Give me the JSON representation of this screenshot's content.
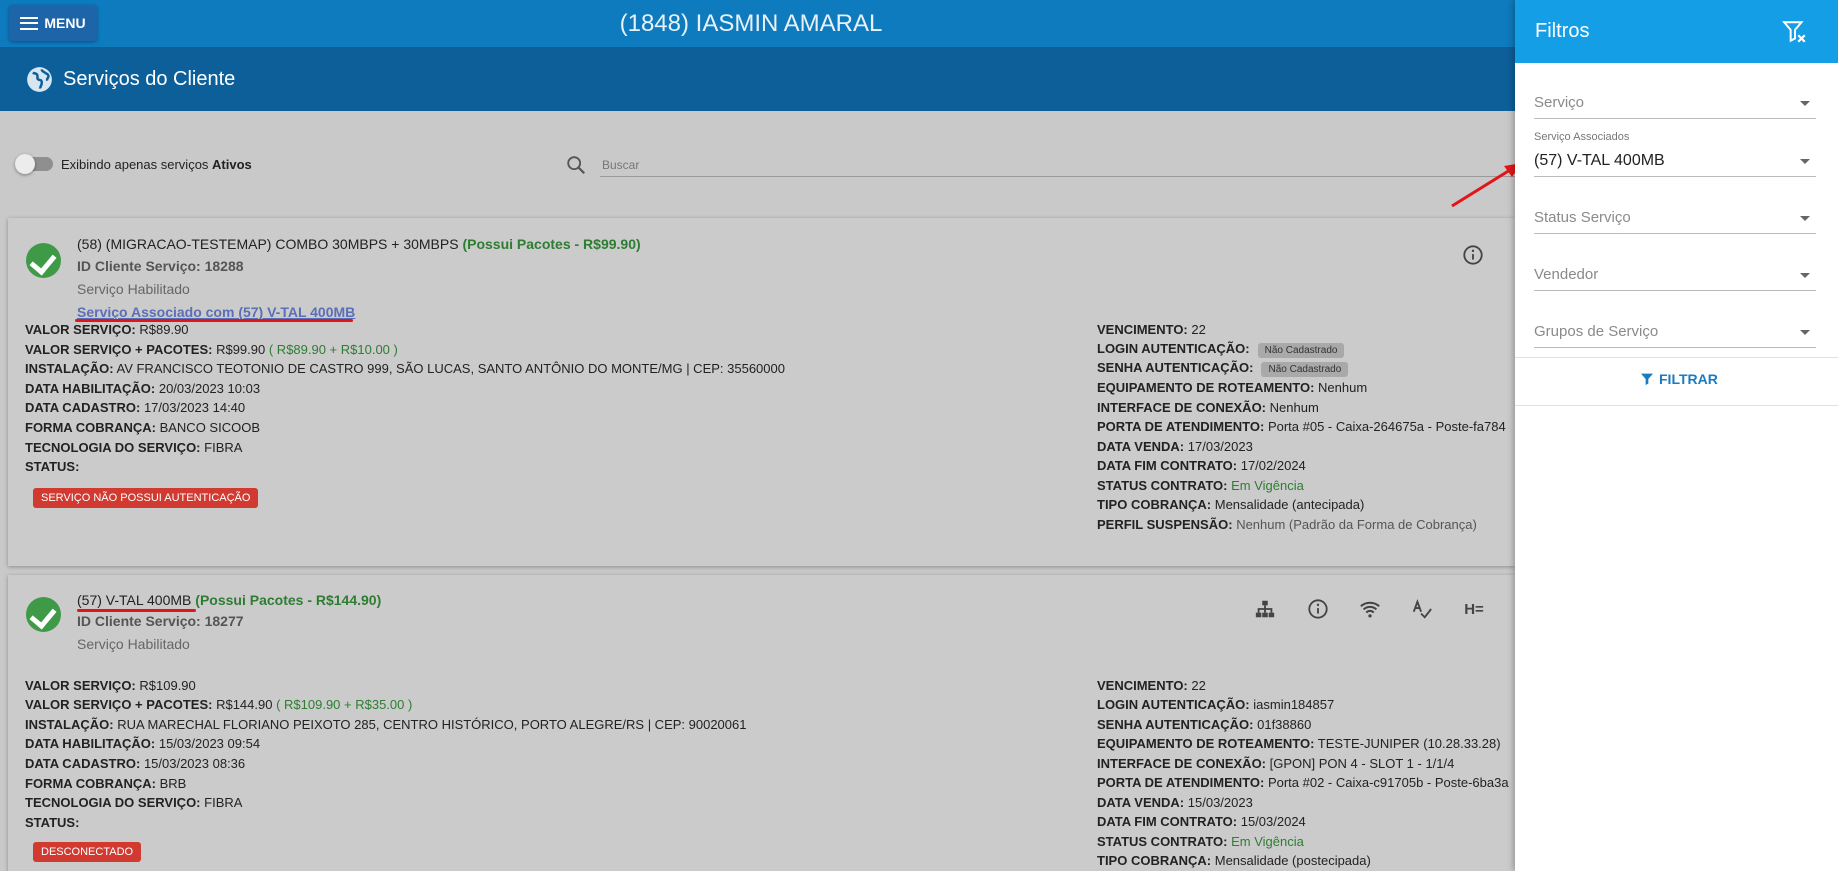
{
  "topbar": {
    "menu_label": "MENU",
    "client_title": "(1848) IASMIN AMARAL"
  },
  "subheader": {
    "title": "Serviços do Cliente",
    "icon": "globe-icon"
  },
  "toolbar": {
    "toggle_prefix": "Exibindo apenas serviços",
    "toggle_bold": "Ativos",
    "search_placeholder": "Buscar"
  },
  "services": [
    {
      "name": "(58) (MIGRACAO-TESTEMAP) COMBO 30MBPS + 30MBPS",
      "packages": "(Possui Pacotes - R$99.90)",
      "id_line": "ID Cliente Serviço: 18288",
      "status_text": "Serviço Habilitado",
      "associated_link": "Serviço Associado com (57) V-TAL 400MB",
      "left": {
        "valor_servico_lbl": "VALOR SERVIÇO:",
        "valor_servico": "R$89.90",
        "valor_pacotes_lbl": "VALOR SERVIÇO + PACOTES:",
        "valor_pacotes": "R$99.90",
        "valor_pacotes_detail": "( R$89.90 + R$10.00 )",
        "instalacao_lbl": "INSTALAÇÃO:",
        "instalacao": "AV FRANCISCO TEOTONIO DE CASTRO 999, SÃO LUCAS, SANTO ANTÔNIO DO MONTE/MG | CEP: 35560000",
        "data_hab_lbl": "DATA HABILITAÇÃO:",
        "data_hab": "20/03/2023 10:03",
        "data_cad_lbl": "DATA CADASTRO:",
        "data_cad": "17/03/2023 14:40",
        "forma_lbl": "FORMA COBRANÇA:",
        "forma": "BANCO SICOOB",
        "tec_lbl": "TECNOLOGIA DO SERVIÇO:",
        "tec": "FIBRA",
        "status_lbl": "STATUS:",
        "status_badge": "SERVIÇO NÃO POSSUI AUTENTICAÇÃO"
      },
      "right": {
        "venc_lbl": "VENCIMENTO:",
        "venc": "22",
        "login_lbl": "LOGIN AUTENTICAÇÃO:",
        "login_badge": "Não Cadastrado",
        "senha_lbl": "SENHA AUTENTICAÇÃO:",
        "senha_badge": "Não Cadastrado",
        "equip_lbl": "EQUIPAMENTO DE ROTEAMENTO:",
        "equip": "Nenhum",
        "interface_lbl": "INTERFACE DE CONEXÃO:",
        "interface": "Nenhum",
        "porta_lbl": "PORTA DE ATENDIMENTO:",
        "porta": "Porta #05 - Caixa-264675a - Poste-fa784",
        "data_venda_lbl": "DATA VENDA:",
        "data_venda": "17/03/2023",
        "data_fim_lbl": "DATA FIM CONTRATO:",
        "data_fim": "17/02/2024",
        "status_contrato_lbl": "STATUS CONTRATO:",
        "status_contrato": "Em Vigência",
        "tipo_cob_lbl": "TIPO COBRANÇA:",
        "tipo_cob": "Mensalidade (antecipada)",
        "perfil_lbl": "PERFIL SUSPENSÃO:",
        "perfil": "Nenhum (Padrão da Forma de Cobrança)"
      }
    },
    {
      "name": "(57) V-TAL 400MB",
      "packages": "(Possui Pacotes - R$144.90)",
      "id_line": "ID Cliente Serviço: 18277",
      "status_text": "Serviço Habilitado",
      "left": {
        "valor_servico_lbl": "VALOR SERVIÇO:",
        "valor_servico": "R$109.90",
        "valor_pacotes_lbl": "VALOR SERVIÇO + PACOTES:",
        "valor_pacotes": "R$144.90",
        "valor_pacotes_detail": "( R$109.90 + R$35.00 )",
        "instalacao_lbl": "INSTALAÇÃO:",
        "instalacao": "RUA MARECHAL FLORIANO PEIXOTO 285, CENTRO HISTÓRICO, PORTO ALEGRE/RS | CEP: 90020061",
        "data_hab_lbl": "DATA HABILITAÇÃO:",
        "data_hab": "15/03/2023 09:54",
        "data_cad_lbl": "DATA CADASTRO:",
        "data_cad": "15/03/2023 08:36",
        "forma_lbl": "FORMA COBRANÇA:",
        "forma": "BRB",
        "tec_lbl": "TECNOLOGIA DO SERVIÇO:",
        "tec": "FIBRA",
        "status_lbl": "STATUS:",
        "status_badge": "DESCONECTADO"
      },
      "right": {
        "venc_lbl": "VENCIMENTO:",
        "venc": "22",
        "login_lbl": "LOGIN AUTENTICAÇÃO:",
        "login": "iasmin184857",
        "senha_lbl": "SENHA AUTENTICAÇÃO:",
        "senha": "01f38860",
        "equip_lbl": "EQUIPAMENTO DE ROTEAMENTO:",
        "equip": "TESTE-JUNIPER (10.28.33.28)",
        "interface_lbl": "INTERFACE DE CONEXÃO:",
        "interface": "[GPON] PON 4 - SLOT 1 - 1/1/4",
        "porta_lbl": "PORTA DE ATENDIMENTO:",
        "porta": "Porta #02 - Caixa-c91705b - Poste-6ba3a",
        "data_venda_lbl": "DATA VENDA:",
        "data_venda": "15/03/2023",
        "data_fim_lbl": "DATA FIM CONTRATO:",
        "data_fim": "15/03/2024",
        "status_contrato_lbl": "STATUS CONTRATO:",
        "status_contrato": "Em Vigência",
        "tipo_cob_lbl": "TIPO COBRANÇA:",
        "tipo_cob": "Mensalidade (postecipada)"
      }
    }
  ],
  "filters": {
    "title": "Filtros",
    "clear_icon": "filter-clear-icon",
    "servico_placeholder": "Serviço",
    "servico_assoc_label": "Serviço Associados",
    "servico_assoc_value": "(57) V-TAL 400MB",
    "status_placeholder": "Status Serviço",
    "vendedor_placeholder": "Vendedor",
    "grupos_placeholder": "Grupos de Serviço",
    "filtrar_label": "FILTRAR"
  },
  "colors": {
    "topbar": "#0d7bbd",
    "subheader": "#0d5f9a",
    "panel_header": "#149ee6",
    "success": "#3f9a48",
    "danger": "#d13a30",
    "annotation_red": "#e21616"
  }
}
